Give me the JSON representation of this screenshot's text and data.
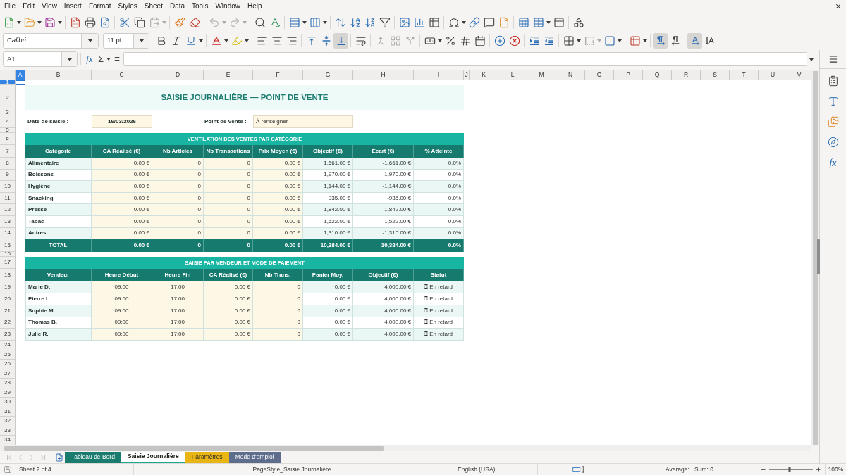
{
  "menu_bar": [
    "File",
    "Edit",
    "View",
    "Insert",
    "Format",
    "Styles",
    "Sheet",
    "Data",
    "Tools",
    "Window",
    "Help"
  ],
  "standard_toolbar": [
    {
      "disabled": false
    },
    {
      "disabled": false
    },
    {
      "disabled": false
    },
    {
      "disabled": false
    },
    {
      "disabled": false
    },
    {
      "disabled": false
    },
    {
      "disabled": false
    },
    {
      "disabled": false
    },
    {
      "disabled": true
    },
    {
      "disabled": false
    },
    {
      "disabled": false
    },
    {
      "disabled": true
    },
    {
      "disabled": true
    },
    {
      "disabled": false
    },
    {
      "disabled": false
    },
    {
      "disabled": false
    },
    {
      "disabled": false
    },
    {
      "disabled": false
    },
    {
      "disabled": false
    },
    {
      "disabled": false
    },
    {
      "disabled": false
    },
    {
      "disabled": false
    },
    {
      "disabled": false
    },
    {
      "disabled": false
    },
    {
      "disabled": false
    },
    {
      "disabled": false
    },
    {
      "disabled": false
    },
    {
      "disabled": false
    },
    {
      "disabled": false
    },
    {
      "disabled": false
    },
    {
      "disabled": false
    },
    {
      "disabled": false
    }
  ],
  "formatting_toolbar": {
    "font_name": "Calibri",
    "font_size": "11 pt",
    "buttons": [
      {
        "active": false,
        "disabled": false
      },
      {
        "active": false,
        "disabled": false
      },
      {
        "active": false,
        "disabled": false
      },
      {
        "active": false,
        "disabled": false
      },
      {
        "active": false,
        "disabled": false
      },
      {
        "active": false,
        "disabled": false
      },
      {
        "active": false,
        "disabled": false
      },
      {
        "active": false,
        "disabled": false
      },
      {
        "active": false,
        "disabled": false
      },
      {
        "active": false,
        "disabled": false
      },
      {
        "active": true,
        "disabled": false
      },
      {
        "active": false,
        "disabled": false
      },
      {
        "active": false,
        "disabled": true
      },
      {
        "active": false,
        "disabled": true
      },
      {
        "active": false,
        "disabled": true
      },
      {
        "active": false,
        "disabled": false
      },
      {
        "active": false,
        "disabled": false
      },
      {
        "active": false,
        "disabled": false
      },
      {
        "active": false,
        "disabled": false
      },
      {
        "active": false,
        "disabled": false
      },
      {
        "active": false,
        "disabled": false
      },
      {
        "active": false,
        "disabled": false
      },
      {
        "active": false,
        "disabled": false
      },
      {
        "active": false,
        "disabled": false
      },
      {
        "active": false,
        "disabled": true
      },
      {
        "active": false,
        "disabled": false
      },
      {
        "active": false,
        "disabled": false
      },
      {
        "active": true,
        "disabled": false
      },
      {
        "active": false,
        "disabled": false
      },
      {
        "active": true,
        "disabled": false
      },
      {
        "active": false,
        "disabled": false
      }
    ]
  },
  "formula_bar": {
    "name_box": "A1",
    "function_wizard": "fx",
    "sum": "Σ",
    "equals": "="
  },
  "column_headers": [
    {
      "label": "A",
      "selected": true
    },
    {
      "label": "B",
      "selected": false
    },
    {
      "label": "C",
      "selected": false
    },
    {
      "label": "D",
      "selected": false
    },
    {
      "label": "E",
      "selected": false
    },
    {
      "label": "F",
      "selected": false
    },
    {
      "label": "G",
      "selected": false
    },
    {
      "label": "H",
      "selected": false
    },
    {
      "label": "I",
      "selected": false
    },
    {
      "label": "J",
      "selected": false
    },
    {
      "label": "K",
      "selected": false
    },
    {
      "label": "L",
      "selected": false
    },
    {
      "label": "M",
      "selected": false
    },
    {
      "label": "N",
      "selected": false
    },
    {
      "label": "O",
      "selected": false
    },
    {
      "label": "P",
      "selected": false
    },
    {
      "label": "Q",
      "selected": false
    },
    {
      "label": "R",
      "selected": false
    },
    {
      "label": "S",
      "selected": false
    },
    {
      "label": "T",
      "selected": false
    },
    {
      "label": "U",
      "selected": false
    },
    {
      "label": "V",
      "selected": false
    }
  ],
  "row_headers": [
    {
      "label": "1",
      "selected": true
    },
    {
      "label": "2",
      "selected": false
    },
    {
      "label": "3",
      "selected": false
    },
    {
      "label": "4",
      "selected": false
    },
    {
      "label": "5",
      "selected": false
    },
    {
      "label": "6",
      "selected": false
    },
    {
      "label": "7",
      "selected": false
    },
    {
      "label": "8",
      "selected": false
    },
    {
      "label": "9",
      "selected": false
    },
    {
      "label": "10",
      "selected": false
    },
    {
      "label": "11",
      "selected": false
    },
    {
      "label": "12",
      "selected": false
    },
    {
      "label": "13",
      "selected": false
    },
    {
      "label": "14",
      "selected": false
    },
    {
      "label": "15",
      "selected": false
    },
    {
      "label": "16",
      "selected": false
    },
    {
      "label": "17",
      "selected": false
    },
    {
      "label": "18",
      "selected": false
    },
    {
      "label": "19",
      "selected": false
    },
    {
      "label": "20",
      "selected": false
    },
    {
      "label": "21",
      "selected": false
    },
    {
      "label": "22",
      "selected": false
    },
    {
      "label": "23",
      "selected": false
    },
    {
      "label": "24",
      "selected": false
    },
    {
      "label": "25",
      "selected": false
    },
    {
      "label": "26",
      "selected": false
    },
    {
      "label": "27",
      "selected": false
    },
    {
      "label": "28",
      "selected": false
    },
    {
      "label": "29",
      "selected": false
    },
    {
      "label": "30",
      "selected": false
    },
    {
      "label": "31",
      "selected": false
    },
    {
      "label": "32",
      "selected": false
    },
    {
      "label": "33",
      "selected": false
    },
    {
      "label": "34",
      "selected": false
    }
  ],
  "sheet": {
    "title": "SAISIE JOURNALIÈRE — POINT DE VENTE",
    "entry_date": {
      "label": "Date de saisie :",
      "value": "16/03/2026"
    },
    "point_of_sale": {
      "label": "Point de vente :",
      "value": "À renseigner"
    },
    "category_table": {
      "banner": "VENTILATION DES VENTES PAR CATÉGORIE",
      "columns": [
        {
          "label": "Catégorie",
          "kind": "label"
        },
        {
          "label": "CA Réalisé (€)",
          "kind": "input"
        },
        {
          "label": "Nb Articles",
          "kind": "input"
        },
        {
          "label": "Nb Transactions",
          "kind": "input"
        },
        {
          "label": "Prix Moyen (€)",
          "kind": "input"
        },
        {
          "label": "Objectif (€)",
          "kind": "formula"
        },
        {
          "label": "Écart (€)",
          "kind": "formula"
        },
        {
          "label": "% Atteinte",
          "kind": "formula"
        }
      ],
      "rows": [
        [
          "Alimentaire",
          "0.00 €",
          "0",
          "0",
          "0.00 €",
          "1,661.00 €",
          "-1,661.00 €",
          "0.0%"
        ],
        [
          "Boissons",
          "0.00 €",
          "0",
          "0",
          "0.00 €",
          "1,970.00 €",
          "-1,970.00 €",
          "0.0%"
        ],
        [
          "Hygiène",
          "0.00 €",
          "0",
          "0",
          "0.00 €",
          "1,144.00 €",
          "-1,144.00 €",
          "0.0%"
        ],
        [
          "Snacking",
          "0.00 €",
          "0",
          "0",
          "0.00 €",
          "935.00 €",
          "-935.00 €",
          "0.0%"
        ],
        [
          "Presse",
          "0.00 €",
          "0",
          "0",
          "0.00 €",
          "1,842.00 €",
          "-1,842.00 €",
          "0.0%"
        ],
        [
          "Tabac",
          "0.00 €",
          "0",
          "0",
          "0.00 €",
          "1,522.00 €",
          "-1,522.00 €",
          "0.0%"
        ],
        [
          "Autres",
          "0.00 €",
          "0",
          "0",
          "0.00 €",
          "1,310.00 €",
          "-1,310.00 €",
          "0.0%"
        ]
      ],
      "total": [
        "TOTAL",
        "0.00 €",
        "0",
        "0",
        "0.00 €",
        "10,384.00 €",
        "-10,384.00 €",
        "0.0%"
      ]
    },
    "vendor_table": {
      "banner": "SAISIE PAR VENDEUR ET MODE DE PAIEMENT",
      "columns": [
        {
          "label": "Vendeur",
          "kind": "label"
        },
        {
          "label": "Heure Début",
          "kind": "time"
        },
        {
          "label": "Heure Fin",
          "kind": "time"
        },
        {
          "label": "CA Réalisé (€)",
          "kind": "input"
        },
        {
          "label": "Nb Trans.",
          "kind": "input"
        },
        {
          "label": "Panier Moy.",
          "kind": "formula"
        },
        {
          "label": "Objectif (€)",
          "kind": "formula"
        },
        {
          "label": "Statut",
          "kind": "status"
        }
      ],
      "rows": [
        [
          "Marie D.",
          "09:00",
          "17:00",
          "0.00 €",
          "0",
          "0.00 €",
          "4,000.00 €",
          "⍰ En retard"
        ],
        [
          "Pierre L.",
          "09:00",
          "17:00",
          "0.00 €",
          "0",
          "0.00 €",
          "4,000.00 €",
          "⍰ En retard"
        ],
        [
          "Sophie M.",
          "09:00",
          "17:00",
          "0.00 €",
          "0",
          "0.00 €",
          "4,000.00 €",
          "⍰ En retard"
        ],
        [
          "Thomas B.",
          "09:00",
          "17:00",
          "0.00 €",
          "0",
          "0.00 €",
          "4,000.00 €",
          "⍰ En retard"
        ],
        [
          "Julie R.",
          "09:00",
          "17:00",
          "0.00 €",
          "0",
          "0.00 €",
          "4,000.00 €",
          "⍰ En retard"
        ]
      ]
    }
  },
  "sheet_tabs": [
    {
      "label": "Tableau de Bord",
      "selected": false,
      "color": "#1a7b6f"
    },
    {
      "label": "Saisie Journalière",
      "selected": true,
      "color": "#1aa894"
    },
    {
      "label": "Paramètres",
      "selected": false,
      "color": "#e9b514"
    },
    {
      "label": "Mode d'emploi",
      "selected": false,
      "color": "#5f6d8c"
    }
  ],
  "sidebar": {
    "functions": "fx"
  },
  "status_bar": {
    "sheet_position": "Sheet 2 of 4",
    "page_style": "PageStyle_Saisie Journalière",
    "language": "English (USA)",
    "selection_summary": "Average: ; Sum: 0",
    "zoom_slider": {
      "level": 0.47
    },
    "zoom": "100%"
  }
}
